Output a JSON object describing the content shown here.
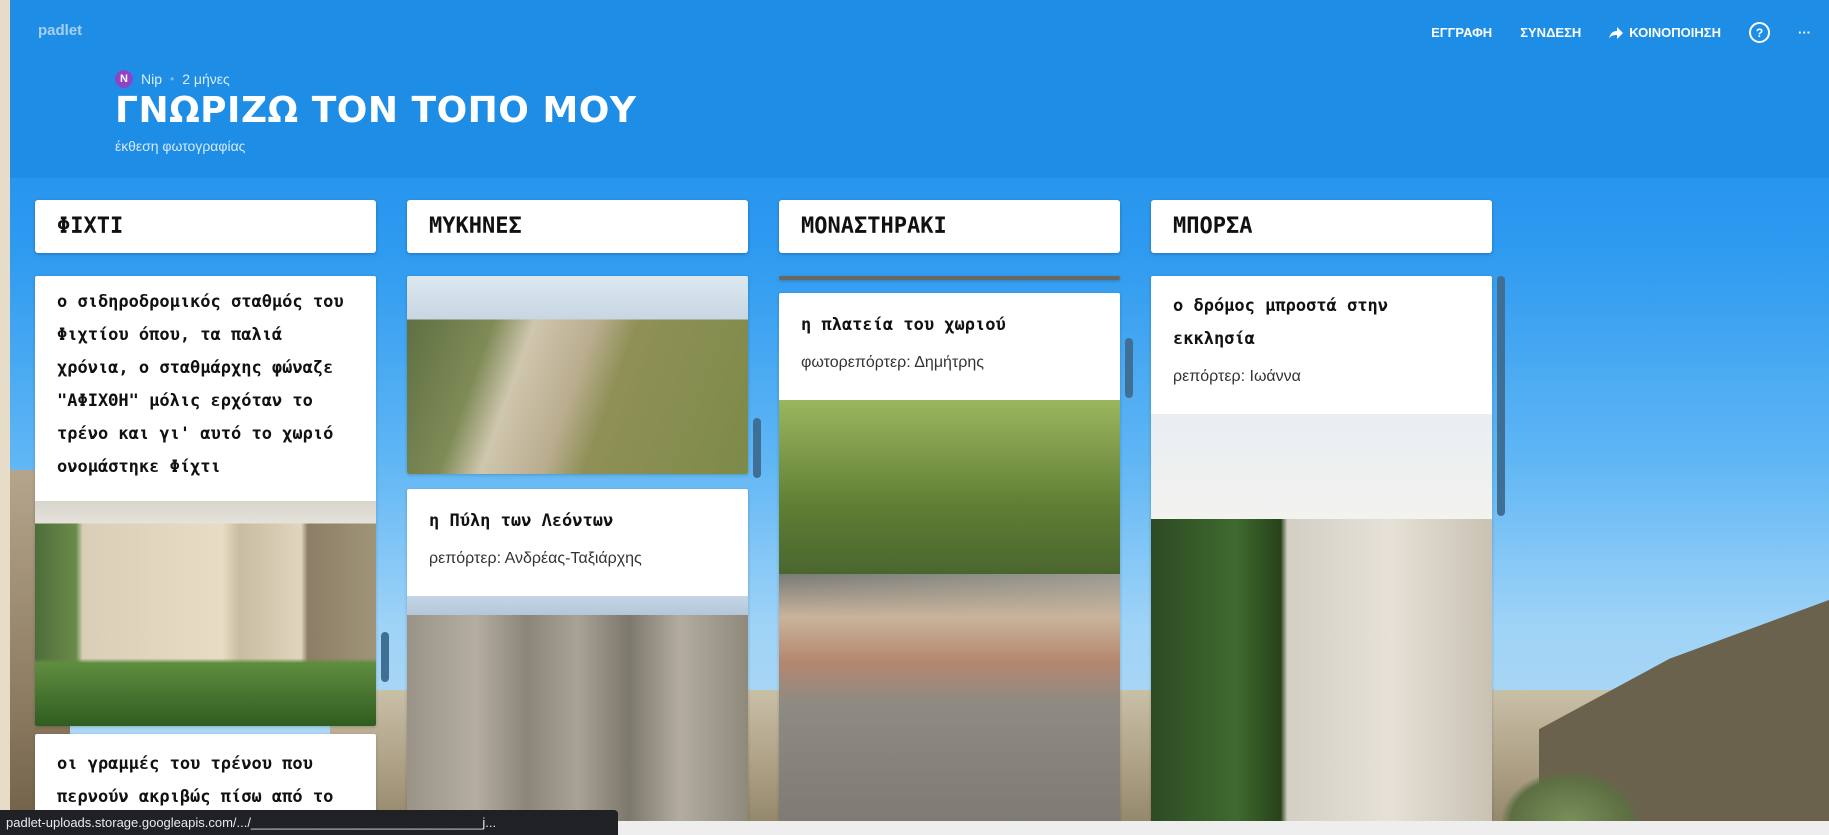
{
  "brand": "padlet",
  "nav": {
    "signup": "ΕΓΓΡΑΦΗ",
    "login": "ΣΥΝΔΕΣΗ",
    "share": "ΚΟΙΝΟΠΟΙΗΣΗ",
    "help": "?",
    "more": "···"
  },
  "author": {
    "initial": "N",
    "name": "Nip",
    "time": "2 μήνες"
  },
  "board": {
    "title": "ΓΝΩΡΙΖΩ ΤΟΝ ΤΟΠΟ ΜΟΥ",
    "subtitle": "έκθεση φωτογραφίας"
  },
  "columns": [
    {
      "title": "ΦΙΧΤΙ",
      "cards": [
        {
          "title": "ο σιδηροδρομικός σταθμός του Φιχτίου όπου, τα παλιά χρόνια, ο σταθμάρχης φώναζε \"ΑΦΙΧΘΗ\" μόλις ερχόταν το τρένο και γι' αυτό το χωριό ονομάστηκε Φίχτι"
        },
        {
          "title": "οι γραμμές του τρένου που περνούν ακριβώς πίσω από το"
        }
      ]
    },
    {
      "title": "ΜΥΚΗΝΕΣ",
      "cards": [
        {
          "title": "η Πύλη των Λεόντων",
          "body": "ρεπόρτερ: Ανδρέας-Ταξιάρχης"
        }
      ]
    },
    {
      "title": "ΜΟΝΑΣΤΗΡΑΚΙ",
      "cards": [
        {
          "title": "η πλατεία του χωριού",
          "body": "φωτορεπόρτερ: Δημήτρης"
        }
      ]
    },
    {
      "title": "ΜΠΟΡΣΑ",
      "cards": [
        {
          "title": "ο δρόμος μπροστά στην εκκλησία",
          "body": "ρεπόρτερ: Ιωάννα"
        }
      ]
    }
  ],
  "statusbar": "padlet-uploads.storage.googleapis.com/.../________________________________j...",
  "colors": {
    "header": "#1e8de6",
    "avatar": "#8e44c8"
  }
}
